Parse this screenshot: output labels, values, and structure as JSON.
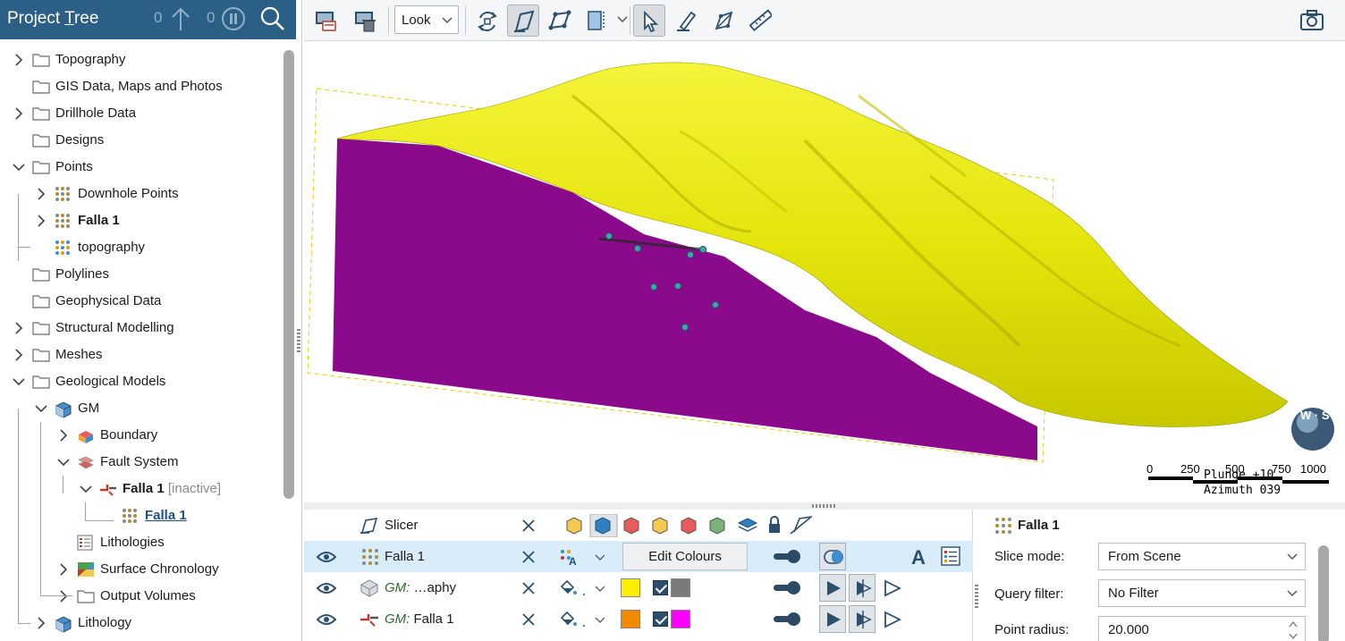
{
  "left_panel": {
    "title": "Project Tree",
    "title_prefix": "Project ",
    "title_hotkey": "T",
    "title_suffix": "ree",
    "upload_count": "0",
    "pause_count": "0",
    "tree": [
      {
        "label": "Topography",
        "icon": "folder-icon",
        "expander": "collapsed"
      },
      {
        "label": "GIS Data, Maps and Photos",
        "icon": "folder-icon",
        "expander": "none"
      },
      {
        "label": "Drillhole Data",
        "icon": "folder-icon",
        "expander": "collapsed"
      },
      {
        "label": "Designs",
        "icon": "folder-icon",
        "expander": "none"
      },
      {
        "label": "Points",
        "icon": "folder-icon",
        "expander": "expanded"
      },
      {
        "label": "Downhole Points",
        "icon": "points-icon",
        "expander": "collapsed"
      },
      {
        "label": "Falla 1",
        "icon": "points-icon",
        "expander": "collapsed"
      },
      {
        "label": "topography",
        "icon": "colored-points-icon",
        "expander": "none"
      },
      {
        "label": "Polylines",
        "icon": "folder-icon",
        "expander": "none"
      },
      {
        "label": "Geophysical Data",
        "icon": "folder-icon",
        "expander": "none"
      },
      {
        "label": "Structural Modelling",
        "icon": "folder-icon",
        "expander": "collapsed"
      },
      {
        "label": "Meshes",
        "icon": "folder-icon",
        "expander": "collapsed"
      },
      {
        "label": "Geological Models",
        "icon": "folder-icon",
        "expander": "expanded"
      },
      {
        "label": "GM",
        "icon": "geomodel-icon",
        "expander": "expanded"
      },
      {
        "label": "Boundary",
        "icon": "boundary-icon",
        "expander": "collapsed"
      },
      {
        "label": "Fault System",
        "icon": "fault-system-icon",
        "expander": "expanded"
      },
      {
        "label": "Falla 1",
        "suffix": "[inactive]",
        "icon": "fault-icon",
        "expander": "expanded"
      },
      {
        "label": "Falla 1",
        "icon": "points-icon",
        "expander": "none"
      },
      {
        "label": "Lithologies",
        "icon": "lithologies-icon",
        "expander": "none"
      },
      {
        "label": "Surface Chronology",
        "icon": "chronology-icon",
        "expander": "collapsed"
      },
      {
        "label": "Output Volumes",
        "icon": "folder-icon",
        "expander": "collapsed"
      },
      {
        "label": "Lithology",
        "icon": "geomodel-icon",
        "expander": "collapsed"
      }
    ]
  },
  "toolbar": {
    "look_label": "Look",
    "icons": [
      "save-scene-icon",
      "delete-scene-icon",
      "rotate-icon",
      "slicer-icon",
      "draw-plane-icon",
      "view-box-icon",
      "select-icon",
      "draw-line-icon",
      "draw-polyline-icon",
      "ruler-icon",
      "screenshot-icon"
    ]
  },
  "scene": {
    "plunge": "Plunge +10",
    "azimuth": "Azimuth 039",
    "scale_labels": [
      "0",
      "250",
      "500",
      "750",
      "1000"
    ],
    "compass_label": "W · S",
    "colors": {
      "surface": "#e6e60c",
      "fault_plane": "#8b0a8b",
      "points": "#3fa6b0"
    }
  },
  "shape_list": {
    "rows": [
      {
        "name": "Slicer",
        "prefix": "",
        "edit_label": ""
      },
      {
        "name": "Falla 1",
        "prefix": "",
        "edit_label": "Edit Colours"
      },
      {
        "name": " …aphy",
        "prefix": "GM:",
        "colour": "#ffee00",
        "back_colour": "#7a7a7a"
      },
      {
        "name": " Falla 1",
        "prefix": "GM:",
        "colour": "#f28a00",
        "back_colour": "#ff00ff"
      }
    ]
  },
  "properties": {
    "title": "Falla 1",
    "slice_mode_label": "Slice mode:",
    "slice_mode_value": "From Scene",
    "query_filter_label": "Query filter:",
    "query_filter_value": "No Filter",
    "point_radius_label": "Point radius:",
    "point_radius_value": "20.000"
  }
}
